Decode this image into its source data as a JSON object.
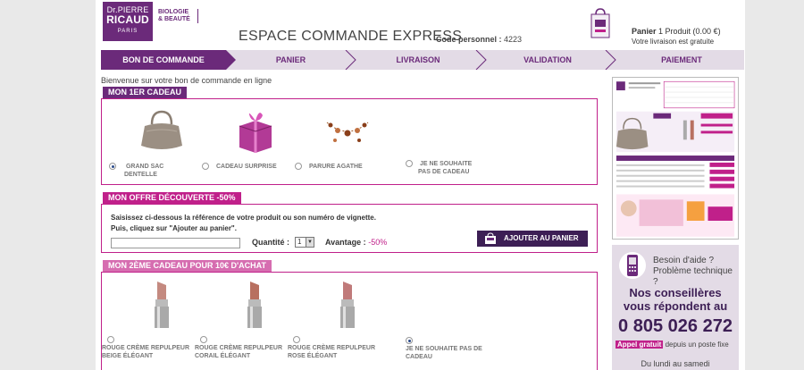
{
  "brand": {
    "logo_line1": "Dr.PIERRE",
    "logo_line2": "RICAUD",
    "logo_line3": "PARIS",
    "tagline1": "BIOLOGIE",
    "tagline2": "& BEAUTÉ",
    "color": "#6b2a7a"
  },
  "header": {
    "title": "ESPACE COMMANDE EXPRESS",
    "code_label": "Code personnel :",
    "code_value": "4223",
    "cart_title_bold": "Panier",
    "cart_title_rest": "1 Produit (0.00 €)",
    "cart_subtitle": "Votre livraison est gratuite"
  },
  "steps": [
    {
      "label": "BON DE COMMANDE",
      "active": true
    },
    {
      "label": "PANIER",
      "active": false
    },
    {
      "label": "LIVRAISON",
      "active": false
    },
    {
      "label": "VALIDATION",
      "active": false
    },
    {
      "label": "PAIEMENT",
      "active": false
    }
  ],
  "welcome": "Bienvenue sur votre bon de commande en ligne",
  "section1": {
    "title": "MON 1ER CADEAU",
    "gifts": [
      {
        "label_line1": "GRAND SAC",
        "label_line2": "DENTELLE",
        "selected": true,
        "icon": "bag-image"
      },
      {
        "label_line1": "CADEAU SURPRISE",
        "label_line2": "",
        "selected": false,
        "icon": "gift-box-image"
      },
      {
        "label_line1": "PARURE AGATHE",
        "label_line2": "",
        "selected": false,
        "icon": "necklace-image"
      },
      {
        "label_line1": "JE NE SOUHAITE",
        "label_line2": "PAS DE CADEAU",
        "selected": false,
        "icon": ""
      }
    ]
  },
  "section2": {
    "title": "MON OFFRE DÉCOUVERTE -50%",
    "instruction_line1": "Saisissez ci-dessous la référence de votre produit ou son numéro de vignette.",
    "instruction_line2": "Puis, cliquez sur \"Ajouter au panier\".",
    "input_value": "",
    "quantity_label": "Quantité :",
    "quantity_value": "1",
    "advantage_label": "Avantage :",
    "advantage_value": "-50%",
    "add_button": "AJOUTER AU PANIER"
  },
  "section3": {
    "title": "MON 2ÈME CADEAU POUR 10€ D'ACHAT",
    "gifts": [
      {
        "label_line1": "ROUGE CRÈME REPULPEUR",
        "label_line2": "BEIGE ÉLÉGANT",
        "selected": false,
        "icon": "lipstick-beige-image"
      },
      {
        "label_line1": "ROUGE CRÈME REPULPEUR",
        "label_line2": "CORAIL ÉLÉGANT",
        "selected": false,
        "icon": "lipstick-coral-image"
      },
      {
        "label_line1": "ROUGE CRÈME REPULPEUR",
        "label_line2": "ROSE ÉLÉGANT",
        "selected": false,
        "icon": "lipstick-rose-image"
      },
      {
        "label_line1": "JE NE SOUHAITE PAS DE",
        "label_line2": "CADEAU",
        "selected": true,
        "icon": ""
      }
    ]
  },
  "help": {
    "question_line1": "Besoin d'aide ?",
    "question_line2": "Problème technique ?",
    "bold_line1": "Nos conseillères",
    "bold_line2": "vous répondent au",
    "phone": "0 805 026 272",
    "free_badge": "Appel gratuit",
    "free_rest": "depuis un poste fixe",
    "hours": "Du lundi au samedi"
  },
  "colors": {
    "purple": "#6b2a7a",
    "dark_purple": "#3d1f55",
    "pink": "#c0208a",
    "light_purple_bg": "#e3dbe6"
  }
}
